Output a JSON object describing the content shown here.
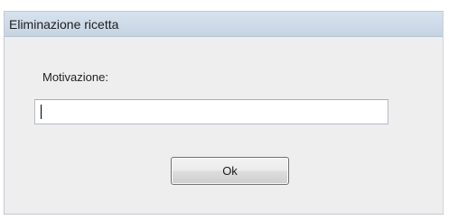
{
  "dialog": {
    "title": "Eliminazione ricetta",
    "field_label": "Motivazione:",
    "field_value": "",
    "ok_label": "Ok"
  }
}
